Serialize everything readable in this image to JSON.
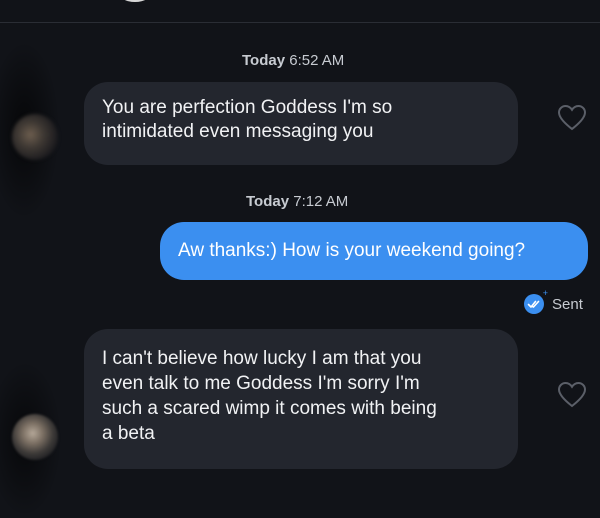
{
  "conversation": {
    "divider": true,
    "messages": [
      {
        "timestamp_prefix": "Today",
        "timestamp_time": "6:52 AM",
        "direction": "incoming",
        "lines": [
          "You are perfection Goddess I'm so",
          "intimidated even messaging you"
        ],
        "like_icon": "heart-outline-icon"
      },
      {
        "timestamp_prefix": "Today",
        "timestamp_time": "7:12 AM",
        "direction": "outgoing",
        "lines": [
          "Aw thanks:) How is your weekend going?"
        ],
        "status": "Sent",
        "status_icon": "double-check-icon"
      },
      {
        "direction": "incoming",
        "lines": [
          "I can't believe how lucky I am that you",
          "even talk to me Goddess I'm sorry I'm",
          "such a scared wimp it comes with being",
          "a beta"
        ],
        "like_icon": "heart-outline-icon"
      }
    ]
  },
  "colors": {
    "background": "#111318",
    "incoming_bubble": "#23262e",
    "outgoing_bubble": "#3b8ff0",
    "timestamp_text": "#c7cbd1"
  }
}
